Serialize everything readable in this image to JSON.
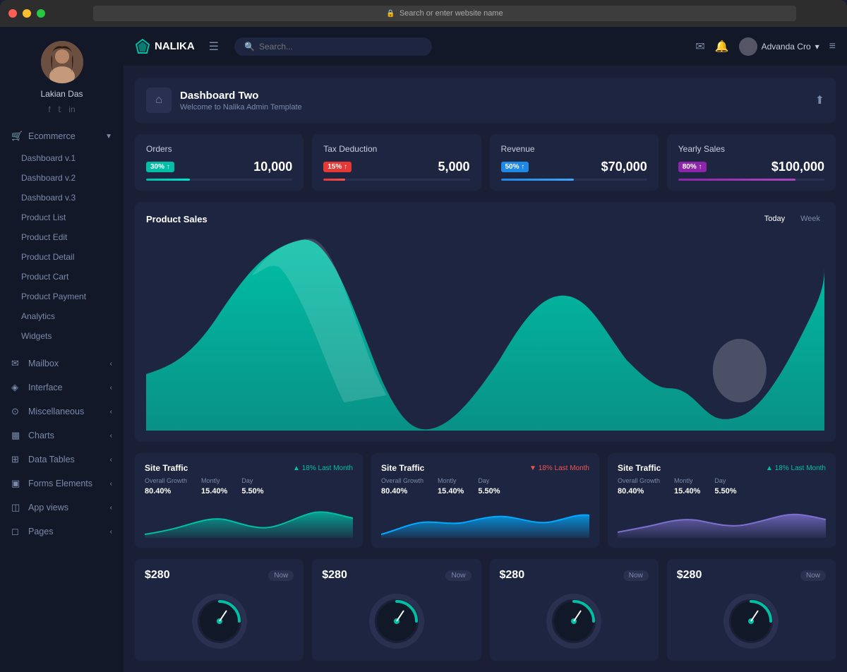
{
  "mac": {
    "url": "Search or enter website name"
  },
  "topbar": {
    "logo": "NALIKA",
    "search_placeholder": "Search...",
    "user_name": "Advanda Cro",
    "hamburger_label": "☰",
    "mail_icon": "✉",
    "bell_icon": "🔔",
    "user_icon": "👤",
    "menu_icon": "≡"
  },
  "sidebar": {
    "user_name": "Lakian Das",
    "ecommerce_label": "Ecommerce",
    "nav_items": [
      {
        "label": "Dashboard v.1",
        "id": "dashboard-v1"
      },
      {
        "label": "Dashboard v.2",
        "id": "dashboard-v2"
      },
      {
        "label": "Dashboard v.3",
        "id": "dashboard-v3"
      },
      {
        "label": "Product List",
        "id": "product-list"
      },
      {
        "label": "Product Edit",
        "id": "product-edit"
      },
      {
        "label": "Product Detail",
        "id": "product-detail"
      },
      {
        "label": "Product Cart",
        "id": "product-cart"
      },
      {
        "label": "Product Payment",
        "id": "product-payment"
      },
      {
        "label": "Analytics",
        "id": "analytics"
      },
      {
        "label": "Widgets",
        "id": "widgets"
      }
    ],
    "section_items": [
      {
        "label": "Mailbox",
        "icon": "✉",
        "id": "mailbox"
      },
      {
        "label": "Interface",
        "icon": "◈",
        "id": "interface"
      },
      {
        "label": "Miscellaneous",
        "icon": "⊙",
        "id": "miscellaneous"
      },
      {
        "label": "Charts",
        "icon": "▦",
        "id": "charts"
      },
      {
        "label": "Data Tables",
        "icon": "⊞",
        "id": "data-tables"
      },
      {
        "label": "Forms Elements",
        "icon": "▣",
        "id": "forms-elements"
      },
      {
        "label": "App views",
        "icon": "◫",
        "id": "app-views"
      },
      {
        "label": "Pages",
        "icon": "◻",
        "id": "pages"
      }
    ]
  },
  "page_header": {
    "title": "Dashboard Two",
    "subtitle": "Welcome to Nalika Admin Template",
    "home_icon": "⌂"
  },
  "stat_cards": [
    {
      "title": "Orders",
      "badge": "30% ↑",
      "badge_type": "teal",
      "value": "10,000",
      "bar_width": "30",
      "bar_type": "teal"
    },
    {
      "title": "Tax Deduction",
      "badge": "15% ↑",
      "badge_type": "red",
      "value": "5,000",
      "bar_width": "15",
      "bar_type": "red"
    },
    {
      "title": "Revenue",
      "badge": "50% ↑",
      "badge_type": "blue",
      "value": "$70,000",
      "bar_width": "50",
      "bar_type": "blue"
    },
    {
      "title": "Yearly Sales",
      "badge": "80% ↑",
      "badge_type": "purple",
      "value": "$100,000",
      "bar_width": "80",
      "bar_type": "purple"
    }
  ],
  "product_sales": {
    "title": "Product Sales",
    "tab_today": "Today",
    "tab_week": "Week"
  },
  "traffic_cards": [
    {
      "title": "Site Traffic",
      "badge": "▲ 18% Last Month",
      "badge_type": "up",
      "stats": [
        {
          "label": "Overall Growth",
          "value": "80.40%"
        },
        {
          "label": "Montly",
          "value": "15.40%"
        },
        {
          "label": "Day",
          "value": "5.50%"
        }
      ],
      "chart_color": "#00bfa5"
    },
    {
      "title": "Site Traffic",
      "badge": "▼ 18% Last Month",
      "badge_type": "down",
      "stats": [
        {
          "label": "Overall Growth",
          "value": "80.40%"
        },
        {
          "label": "Montly",
          "value": "15.40%"
        },
        {
          "label": "Day",
          "value": "5.50%"
        }
      ],
      "chart_color": "#00aaff"
    },
    {
      "title": "Site Traffic",
      "badge": "▲ 18% Last Month",
      "badge_type": "up",
      "stats": [
        {
          "label": "Overall Growth",
          "value": "80.40%"
        },
        {
          "label": "Montly",
          "value": "15.40%"
        },
        {
          "label": "Day",
          "value": "5.50%"
        }
      ],
      "chart_color": "#7c6fcd"
    }
  ],
  "watch_cards": [
    {
      "price": "$280",
      "now_label": "Now"
    },
    {
      "price": "$280",
      "now_label": "Now"
    },
    {
      "price": "$280",
      "now_label": "Now"
    },
    {
      "price": "$280",
      "now_label": "Now"
    }
  ]
}
